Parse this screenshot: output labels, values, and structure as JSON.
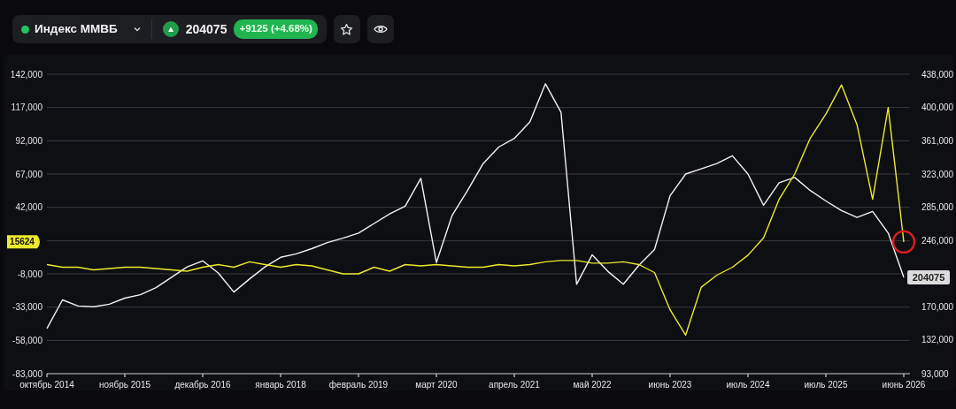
{
  "toolbar": {
    "instrument": "Индекс ММВБ",
    "rising": true,
    "price": "204075",
    "change": "+9125 (+4.68%)"
  },
  "chart": {
    "price_tags": [
      {
        "text": "204075"
      },
      {
        "text": "15624"
      }
    ],
    "highlight": {
      "color": "#d81e1e"
    },
    "chart_data": {
      "type": "line",
      "grid": true,
      "categories": [
        "октябрь 2014",
        null,
        null,
        null,
        null,
        "ноябрь 2015",
        null,
        null,
        null,
        null,
        "декабрь 2016",
        null,
        null,
        null,
        null,
        "январь 2018",
        null,
        null,
        null,
        null,
        "февраль 2019",
        null,
        null,
        null,
        null,
        "март 2020",
        null,
        null,
        null,
        null,
        "апрель 2021",
        null,
        null,
        null,
        null,
        "май 2022",
        null,
        null,
        null,
        null,
        "июнь 2023",
        null,
        null,
        null,
        null,
        "июль 2024",
        null,
        null,
        null,
        null,
        "июль 2025",
        null,
        null,
        null,
        null,
        "июнь 2026"
      ],
      "series": [
        {
          "color": "#f2f2f2",
          "axis": "y2",
          "values": [
            145000,
            178000,
            171000,
            170000,
            173000,
            180000,
            184000,
            192000,
            204000,
            216000,
            223000,
            209000,
            187000,
            202000,
            216000,
            227000,
            231000,
            237000,
            244000,
            249000,
            255000,
            266000,
            277000,
            286000,
            318000,
            221000,
            275000,
            304000,
            335000,
            354000,
            364000,
            383000,
            427000,
            394000,
            196000,
            230000,
            211000,
            196000,
            218000,
            236000,
            298000,
            323000,
            329000,
            335000,
            344000,
            323000,
            287000,
            313000,
            319000,
            304000,
            292000,
            281000,
            273000,
            280000,
            255000,
            204000
          ]
        },
        {
          "color": "#ecea2e",
          "values": [
            -1000,
            -3000,
            -3000,
            -5000,
            -4000,
            -3000,
            -3000,
            -4000,
            -5000,
            -6000,
            -3000,
            -1000,
            -3000,
            1000,
            -1000,
            -3000,
            -1000,
            -2000,
            -5000,
            -8000,
            -8000,
            -3000,
            -6000,
            -1000,
            -2000,
            -1000,
            -2000,
            -3000,
            -3000,
            -1000,
            -2000,
            -1000,
            1000,
            2000,
            2000,
            0,
            0,
            1000,
            -1000,
            -7000,
            -35000,
            -54000,
            -18000,
            -9000,
            -3000,
            6000,
            19000,
            48000,
            67000,
            94000,
            112000,
            134000,
            104000,
            48000,
            117000,
            16000
          ]
        }
      ],
      "ylim": [
        -83000,
        142000
      ],
      "yticks": [
        {
          "value": 142000,
          "label": "142,000"
        },
        {
          "value": 117000,
          "label": "117,000"
        },
        {
          "value": 92000,
          "label": "92,000"
        },
        {
          "value": 67000,
          "label": "67,000"
        },
        {
          "value": 42000,
          "label": "42,000"
        },
        {
          "value": -8000,
          "label": "-8,000"
        },
        {
          "value": -33000,
          "label": "-33,000"
        },
        {
          "value": -58000,
          "label": "-58,000"
        },
        {
          "value": -83000,
          "label": "-83,000"
        }
      ],
      "y2lim": [
        93000,
        438000
      ],
      "y2ticks": [
        {
          "value": 438000,
          "label": "438,000"
        },
        {
          "value": 400000,
          "label": "400,000"
        },
        {
          "value": 361000,
          "label": "361,000"
        },
        {
          "value": 323000,
          "label": "323,000"
        },
        {
          "value": 285000,
          "label": "285,000"
        },
        {
          "value": 246000,
          "label": "246,000"
        },
        {
          "value": 170000,
          "label": "170,000"
        },
        {
          "value": 132000,
          "label": "132,000"
        },
        {
          "value": 93000,
          "label": "93,000"
        }
      ]
    }
  }
}
